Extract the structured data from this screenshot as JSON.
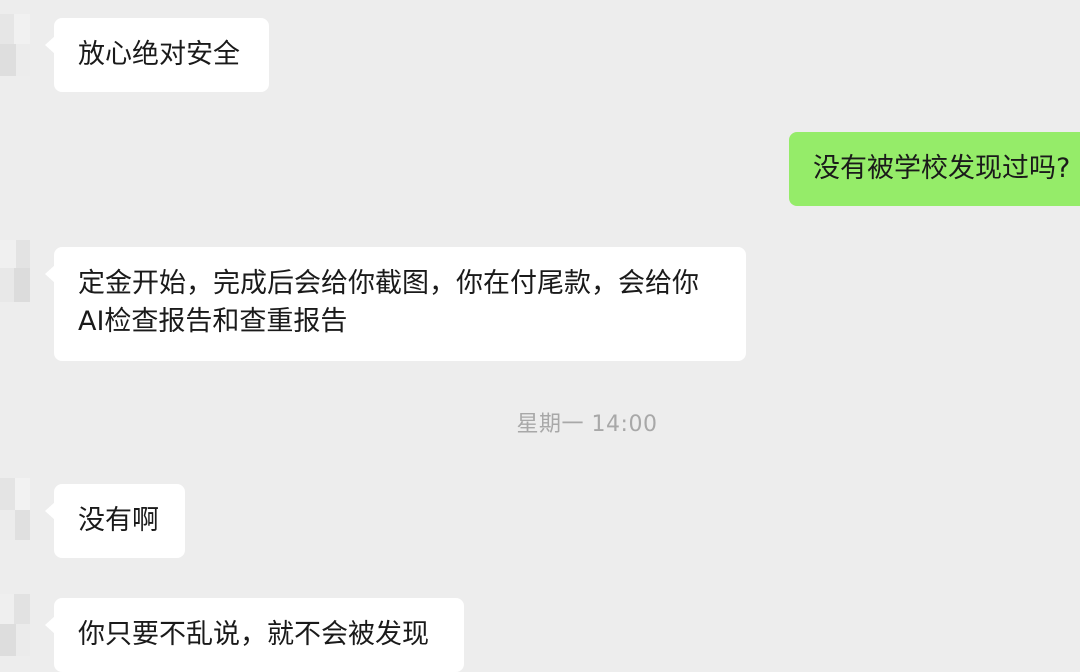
{
  "messages": [
    {
      "sender": "other",
      "text": "放心绝对安全"
    },
    {
      "sender": "self",
      "text": "没有被学校发现过吗?"
    },
    {
      "sender": "other",
      "text_line1": "定金开始，完成后会给你截图，你在付尾款，会给你",
      "text_line2": "AI检查报告和查重报告"
    },
    {
      "sender": "other",
      "text": "没有啊"
    },
    {
      "sender": "other",
      "text": "你只要不乱说，就不会被发现"
    }
  ],
  "timestamp": "星期一 14:00",
  "colors": {
    "background": "#ededed",
    "incoming_bubble": "#ffffff",
    "outgoing_bubble": "#95ec69",
    "timestamp_text": "#a8a8a8"
  }
}
